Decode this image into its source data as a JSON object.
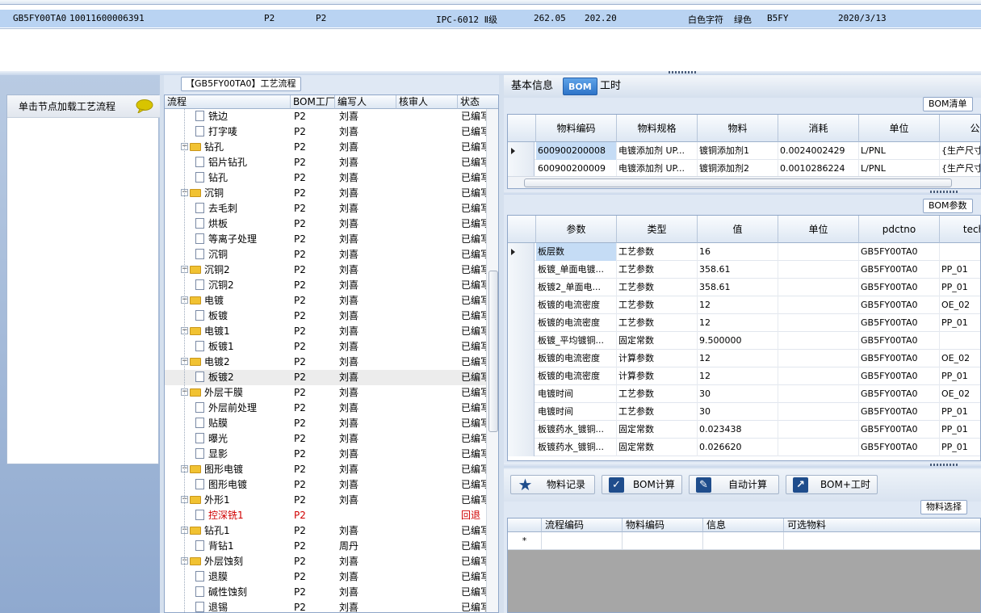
{
  "top_row": {
    "cells": [
      "GB5FY00TA0",
      "10011600006391",
      "P2",
      "P2",
      "IPC-6012 Ⅱ级",
      "262.05",
      "202.20",
      "白色字符",
      "绿色",
      "B5FY",
      "2020/3/13"
    ]
  },
  "left_panel": {
    "load_button_label": "单击节点加载工艺流程"
  },
  "process_title": "【GB5FY00TA0】工艺流程",
  "tree": {
    "columns": [
      "流程",
      "BOM工厂",
      "编写人",
      "核审人",
      "状态"
    ],
    "rows": [
      {
        "label": "铣边",
        "level": 2,
        "factory": "P2",
        "writer": "刘喜",
        "status": "已编写"
      },
      {
        "label": "打字唛",
        "level": 2,
        "factory": "P2",
        "writer": "刘喜",
        "status": "已编写"
      },
      {
        "label": "钻孔",
        "level": 1,
        "factory": "P2",
        "writer": "刘喜",
        "status": "已编写"
      },
      {
        "label": "铝片钻孔",
        "level": 2,
        "factory": "P2",
        "writer": "刘喜",
        "status": "已编写"
      },
      {
        "label": "钻孔",
        "level": 2,
        "factory": "P2",
        "writer": "刘喜",
        "status": "已编写"
      },
      {
        "label": "沉铜",
        "level": 1,
        "factory": "P2",
        "writer": "刘喜",
        "status": "已编写"
      },
      {
        "label": "去毛刺",
        "level": 2,
        "factory": "P2",
        "writer": "刘喜",
        "status": "已编写"
      },
      {
        "label": "烘板",
        "level": 2,
        "factory": "P2",
        "writer": "刘喜",
        "status": "已编写"
      },
      {
        "label": "等离子处理",
        "level": 2,
        "factory": "P2",
        "writer": "刘喜",
        "status": "已编写"
      },
      {
        "label": "沉铜",
        "level": 2,
        "factory": "P2",
        "writer": "刘喜",
        "status": "已编写"
      },
      {
        "label": "沉铜2",
        "level": 1,
        "factory": "P2",
        "writer": "刘喜",
        "status": "已编写"
      },
      {
        "label": "沉铜2",
        "level": 2,
        "factory": "P2",
        "writer": "刘喜",
        "status": "已编写"
      },
      {
        "label": "电镀",
        "level": 1,
        "factory": "P2",
        "writer": "刘喜",
        "status": "已编写"
      },
      {
        "label": "板镀",
        "level": 2,
        "factory": "P2",
        "writer": "刘喜",
        "status": "已编写"
      },
      {
        "label": "电镀1",
        "level": 1,
        "factory": "P2",
        "writer": "刘喜",
        "status": "已编写"
      },
      {
        "label": "板镀1",
        "level": 2,
        "factory": "P2",
        "writer": "刘喜",
        "status": "已编写"
      },
      {
        "label": "电镀2",
        "level": 1,
        "factory": "P2",
        "writer": "刘喜",
        "status": "已编写"
      },
      {
        "label": "板镀2",
        "level": 2,
        "factory": "P2",
        "writer": "刘喜",
        "status": "已编写",
        "selected": true
      },
      {
        "label": "外层干膜",
        "level": 1,
        "factory": "P2",
        "writer": "刘喜",
        "status": "已编写"
      },
      {
        "label": "外层前处理",
        "level": 2,
        "factory": "P2",
        "writer": "刘喜",
        "status": "已编写"
      },
      {
        "label": "贴膜",
        "level": 2,
        "factory": "P2",
        "writer": "刘喜",
        "status": "已编写"
      },
      {
        "label": "曝光",
        "level": 2,
        "factory": "P2",
        "writer": "刘喜",
        "status": "已编写"
      },
      {
        "label": "显影",
        "level": 2,
        "factory": "P2",
        "writer": "刘喜",
        "status": "已编写"
      },
      {
        "label": "图形电镀",
        "level": 1,
        "factory": "P2",
        "writer": "刘喜",
        "status": "已编写"
      },
      {
        "label": "图形电镀",
        "level": 2,
        "factory": "P2",
        "writer": "刘喜",
        "status": "已编写"
      },
      {
        "label": "外形1",
        "level": 1,
        "factory": "P2",
        "writer": "刘喜",
        "status": "已编写"
      },
      {
        "label": "控深铣1",
        "level": 2,
        "factory": "P2",
        "writer": "",
        "status": "回退",
        "red": true
      },
      {
        "label": "钻孔1",
        "level": 1,
        "factory": "P2",
        "writer": "刘喜",
        "status": "已编写"
      },
      {
        "label": "背钻1",
        "level": 2,
        "factory": "P2",
        "writer": "周丹",
        "status": "已编写"
      },
      {
        "label": "外层蚀刻",
        "level": 1,
        "factory": "P2",
        "writer": "刘喜",
        "status": "已编写"
      },
      {
        "label": "退膜",
        "level": 2,
        "factory": "P2",
        "writer": "刘喜",
        "status": "已编写"
      },
      {
        "label": "碱性蚀刻",
        "level": 2,
        "factory": "P2",
        "writer": "刘喜",
        "status": "已编写"
      },
      {
        "label": "退锡",
        "level": 2,
        "factory": "P2",
        "writer": "刘喜",
        "status": "已编写"
      }
    ]
  },
  "tabs": [
    "基本信息",
    "BOM",
    "工时"
  ],
  "bom_list": {
    "title": "BOM清单",
    "columns": [
      "物料编码",
      "物料规格",
      "物料",
      "消耗",
      "单位",
      "公式"
    ],
    "rows": [
      [
        "600900200008",
        "电镀添加剂 UP...",
        "镀铜添加剂1",
        "0.0024002429",
        "L/PNL",
        "{生产尺寸"
      ],
      [
        "600900200009",
        "电镀添加剂 UP...",
        "镀铜添加剂2",
        "0.0010286224",
        "L/PNL",
        "{生产尺寸"
      ]
    ]
  },
  "bom_params": {
    "title": "BOM参数",
    "columns": [
      "参数",
      "类型",
      "值",
      "单位",
      "pdctno",
      "techno"
    ],
    "rows": [
      [
        "板层数",
        "工艺参数",
        "16",
        "",
        "GB5FY00TA0",
        ""
      ],
      [
        "板镀_单面电镀...",
        "工艺参数",
        "358.61",
        "",
        "GB5FY00TA0",
        "PP_01"
      ],
      [
        "板镀2_单面电...",
        "工艺参数",
        "358.61",
        "",
        "GB5FY00TA0",
        "PP_01"
      ],
      [
        "板镀的电流密度",
        "工艺参数",
        "12",
        "",
        "GB5FY00TA0",
        "OE_02"
      ],
      [
        "板镀的电流密度",
        "工艺参数",
        "12",
        "",
        "GB5FY00TA0",
        "PP_01"
      ],
      [
        "板镀_平均镀铜...",
        "固定常数",
        "9.500000",
        "",
        "GB5FY00TA0",
        ""
      ],
      [
        "板镀的电流密度",
        "计算参数",
        "12",
        "",
        "GB5FY00TA0",
        "OE_02"
      ],
      [
        "板镀的电流密度",
        "计算参数",
        "12",
        "",
        "GB5FY00TA0",
        "PP_01"
      ],
      [
        "电镀时间",
        "工艺参数",
        "30",
        "",
        "GB5FY00TA0",
        "OE_02"
      ],
      [
        "电镀时间",
        "工艺参数",
        "30",
        "",
        "GB5FY00TA0",
        "PP_01"
      ],
      [
        "板镀药水_镀铜...",
        "固定常数",
        "0.023438",
        "",
        "GB5FY00TA0",
        "PP_01"
      ],
      [
        "板镀药水_镀铜...",
        "固定常数",
        "0.026620",
        "",
        "GB5FY00TA0",
        "PP_01"
      ]
    ]
  },
  "toolbar": {
    "material_record": "物料记录",
    "bom_calc": "BOM计算",
    "auto_calc": "自动计算",
    "bom_hours": "BOM+工时"
  },
  "material_select": {
    "title": "物料选择",
    "columns": [
      "流程编码",
      "物料编码",
      "信息",
      "可选物料"
    ]
  },
  "icons": {
    "star": "star-icon",
    "check": "check-icon",
    "edit": "edit-icon",
    "export": "export-icon",
    "chat": "chat-bubble-icon"
  }
}
